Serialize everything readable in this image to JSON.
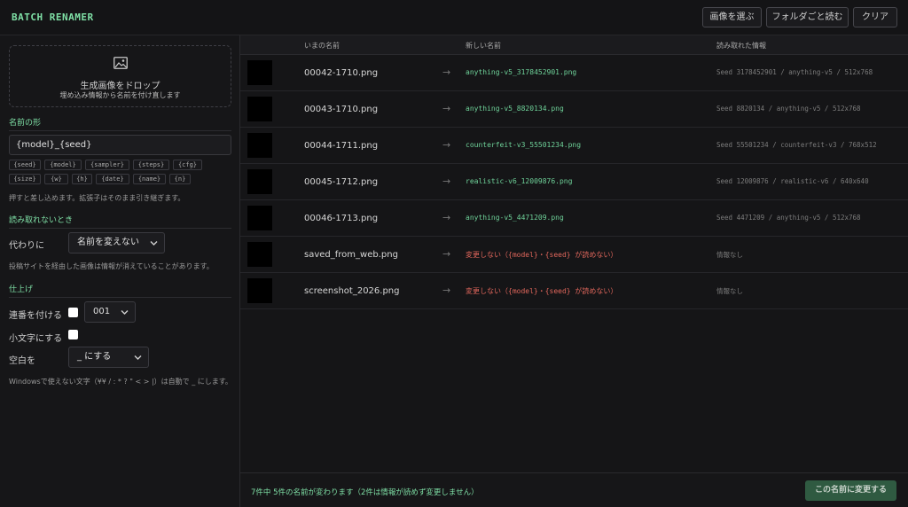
{
  "header": {
    "title": "BATCH RENAMER",
    "buttons": [
      "画像を選ぶ",
      "フォルダごと読む",
      "クリア"
    ]
  },
  "sidebar": {
    "dropzone": {
      "title": "生成画像をドロップ",
      "subtitle": "埋め込み情報から名前を付け直します",
      "icon": "image-icon"
    },
    "naming": {
      "heading": "名前の形",
      "pattern": "{model}_{seed}",
      "tokens": [
        "{seed}",
        "{model}",
        "{sampler}",
        "{steps}",
        "{cfg}",
        "{size}",
        "{w}",
        "{h}",
        "{date}",
        "{name}",
        "{n}"
      ],
      "note": "押すと差し込めます。拡張子はそのまま引き継ぎます。"
    },
    "fallback": {
      "heading": "読み取れないとき",
      "label": "代わりに",
      "value": "名前を変えない",
      "note": "投稿サイトを経由した画像は情報が消えていることがあります。"
    },
    "finish": {
      "heading": "仕上げ",
      "serial_label": "連番を付ける",
      "serial_value": "001",
      "lowercase_label": "小文字にする",
      "space_label": "空白を",
      "space_value": "_ にする",
      "note": "Windowsで使えない文字（¥¥ / : * ? \" < > |）は自動で _ にします。"
    }
  },
  "table": {
    "headers": [
      "いまの名前",
      "新しい名前",
      "読み取れた情報"
    ],
    "arrow": "→",
    "rows": [
      {
        "old": "00042-1710.png",
        "new": "anything-v5_3178452901.png",
        "info": "Seed 3178452901 / anything-v5 / 512x768",
        "status": "ok"
      },
      {
        "old": "00043-1710.png",
        "new": "anything-v5_8820134.png",
        "info": "Seed 8820134 / anything-v5 / 512x768",
        "status": "ok"
      },
      {
        "old": "00044-1711.png",
        "new": "counterfeit-v3_55501234.png",
        "info": "Seed 55501234 / counterfeit-v3 / 768x512",
        "status": "ok"
      },
      {
        "old": "00045-1712.png",
        "new": "realistic-v6_12009876.png",
        "info": "Seed 12009876 / realistic-v6 / 640x640",
        "status": "ok"
      },
      {
        "old": "00046-1713.png",
        "new": "anything-v5_4471209.png",
        "info": "Seed 4471209 / anything-v5 / 512x768",
        "status": "ok"
      },
      {
        "old": "saved_from_web.png",
        "new": "変更しない（{model}・{seed} が読めない）",
        "info": "情報なし",
        "status": "warn"
      },
      {
        "old": "screenshot_2026.png",
        "new": "変更しない（{model}・{seed} が読めない）",
        "info": "情報なし",
        "status": "warn"
      }
    ]
  },
  "footer": {
    "summary": "7件中 5件の名前が変わります（2件は情報が読めず変更しません）",
    "apply_label": "この名前に変更する"
  },
  "colors": {
    "accent": "#7fe0a6",
    "warning": "#e2675c",
    "apply_button": "#2f5a41"
  }
}
